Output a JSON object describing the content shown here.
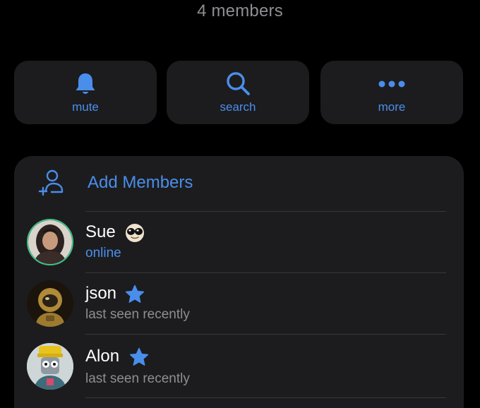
{
  "header": {
    "members_count": "4 members"
  },
  "actions": [
    {
      "label": "mute",
      "icon": "bell-icon"
    },
    {
      "label": "search",
      "icon": "magnifier-icon"
    },
    {
      "label": "more",
      "icon": "ellipsis-icon"
    }
  ],
  "members_card": {
    "add_label": "Add Members",
    "add_icon": "add-person-icon",
    "members": [
      {
        "name": "Sue",
        "status": "online",
        "badge": "sunglasses-emoji"
      },
      {
        "name": "json",
        "status": "last seen recently",
        "badge": "star-icon"
      },
      {
        "name": "Alon",
        "status": "last seen recently",
        "badge": "star-icon"
      }
    ]
  },
  "colors": {
    "background": "#000000",
    "card": "#1c1c1e",
    "accent": "#4a8eec",
    "secondary_text": "#8e8e93",
    "separator": "#38383a",
    "primary_text": "#ffffff"
  }
}
